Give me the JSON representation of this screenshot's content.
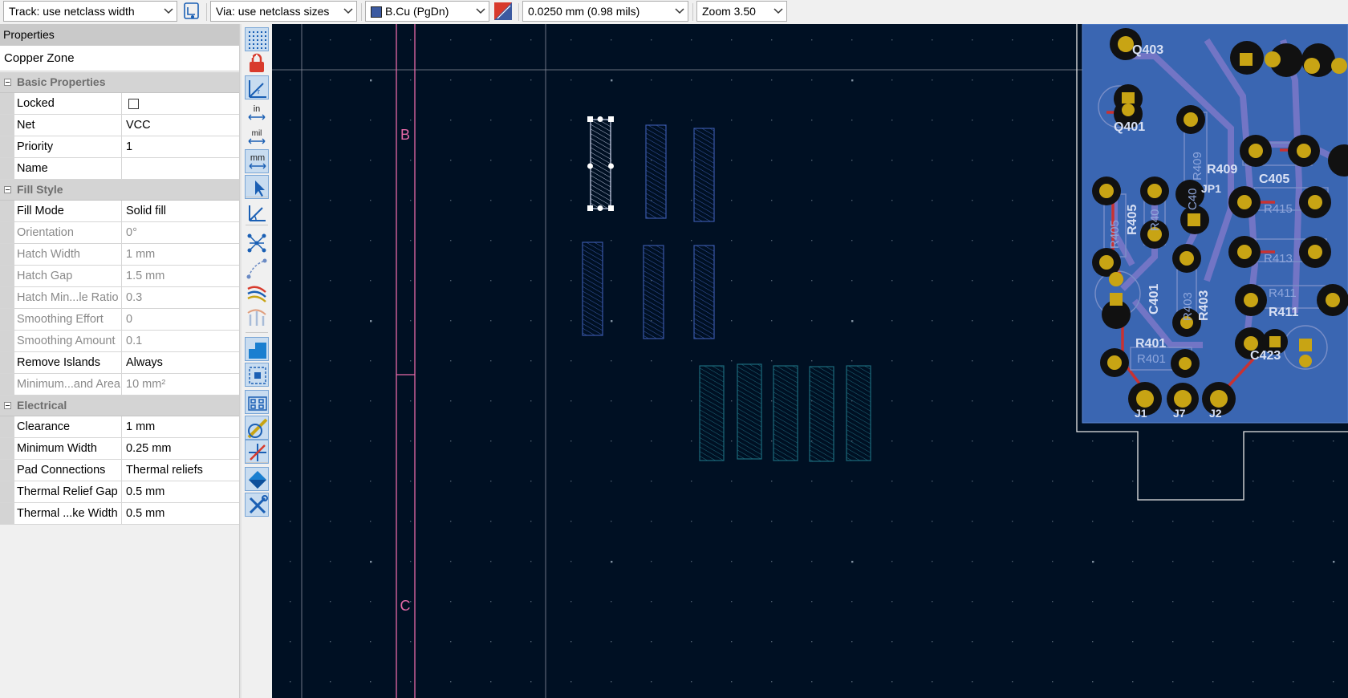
{
  "toolbar": {
    "track_width": "Track: use netclass width",
    "via_size": "Via: use netclass sizes",
    "layer": "B.Cu (PgDn)",
    "grid": "0.0250 mm (0.98 mils)",
    "zoom": "Zoom 3.50",
    "layer_color": "#3c5aa0"
  },
  "properties": {
    "title": "Properties",
    "item_type": "Copper Zone",
    "categories": [
      {
        "label": "Basic Properties",
        "rows": [
          {
            "key": "Locked",
            "value": "",
            "checkbox": true,
            "checked": false
          },
          {
            "key": "Net",
            "value": "VCC"
          },
          {
            "key": "Priority",
            "value": "1"
          },
          {
            "key": "Name",
            "value": ""
          }
        ]
      },
      {
        "label": "Fill Style",
        "rows": [
          {
            "key": "Fill Mode",
            "value": "Solid fill"
          },
          {
            "key": "Orientation",
            "value": "0°",
            "disabled": true
          },
          {
            "key": "Hatch Width",
            "value": "1 mm",
            "disabled": true
          },
          {
            "key": "Hatch Gap",
            "value": "1.5 mm",
            "disabled": true
          },
          {
            "key": "Hatch Min...le Ratio",
            "value": "0.3",
            "disabled": true
          },
          {
            "key": "Smoothing Effort",
            "value": "0",
            "disabled": true
          },
          {
            "key": "Smoothing Amount",
            "value": "0.1",
            "disabled": true
          },
          {
            "key": "Remove Islands",
            "value": "Always"
          },
          {
            "key": "Minimum...and Area",
            "value": "10 mm²",
            "disabled": true
          }
        ]
      },
      {
        "label": "Electrical",
        "rows": [
          {
            "key": "Clearance",
            "value": "1 mm"
          },
          {
            "key": "Minimum Width",
            "value": "0.25 mm"
          },
          {
            "key": "Pad Connections",
            "value": "Thermal reliefs"
          },
          {
            "key": "Thermal Relief Gap",
            "value": "0.5 mm"
          },
          {
            "key": "Thermal ...ke Width",
            "value": "0.5 mm"
          }
        ]
      }
    ]
  },
  "left_toolbar": [
    {
      "name": "grid-toggle-icon"
    },
    {
      "name": "lock-icon"
    },
    {
      "name": "polar-coords-icon"
    },
    {
      "name": "unit-inches-icon",
      "text": "in"
    },
    {
      "name": "unit-mils-icon",
      "text": "mil"
    },
    {
      "name": "unit-mm-icon",
      "text": "mm"
    },
    {
      "name": "cursor-shape-icon"
    },
    {
      "name": "angle-constraint-icon"
    },
    {
      "name": "ratsnest-icon"
    },
    {
      "name": "curved-ratsnest-icon"
    },
    {
      "name": "net-highlight-icon"
    },
    {
      "name": "high-contrast-icon"
    },
    {
      "name": "zone-fill-icon"
    },
    {
      "name": "zone-outline-icon"
    },
    {
      "name": "pad-outline-icon"
    },
    {
      "name": "via-outline-icon"
    },
    {
      "name": "track-outline-icon"
    },
    {
      "name": "layers-manager-icon"
    },
    {
      "name": "properties-panel-icon"
    }
  ],
  "canvas": {
    "sheet_labels": [
      "B",
      "C"
    ],
    "ref_labels": [
      "Q403",
      "Q401",
      "R409",
      "R405",
      "C401",
      "R401",
      "R401",
      "R403",
      "R411",
      "R411",
      "C405",
      "R415",
      "R413",
      "C423",
      "J1",
      "J7",
      "J2",
      "JP1",
      "R40",
      "C40"
    ],
    "colors": {
      "background": "#001023",
      "board_fill": "#3a66b2",
      "pad": "#c8a414",
      "track": "#c83232",
      "sheet_frame": "#e66aa8",
      "zone_outline": "#4a6ec4"
    }
  }
}
